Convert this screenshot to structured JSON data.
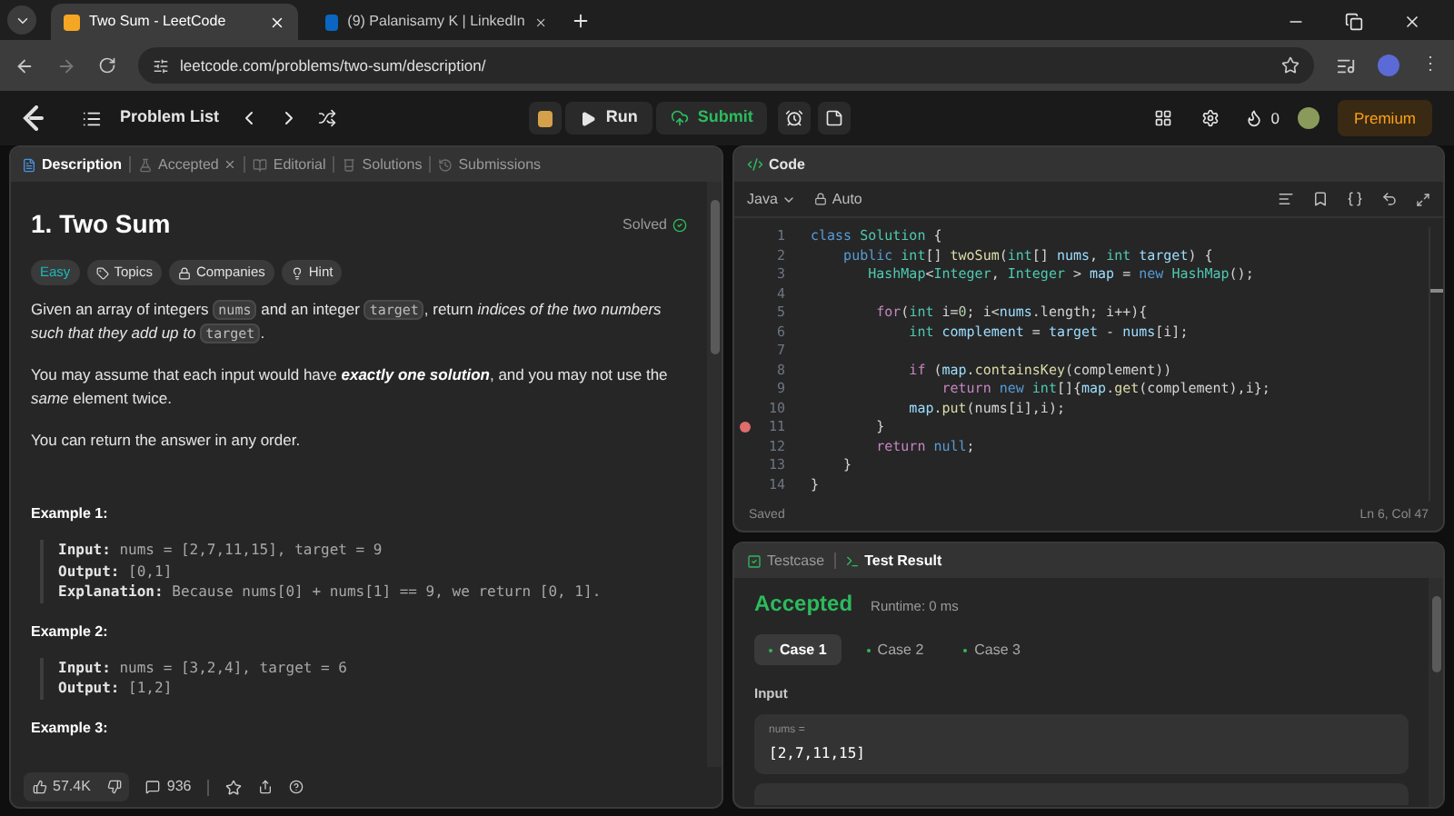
{
  "browser": {
    "tabs": [
      {
        "title": "Two Sum - LeetCode",
        "selected": true
      },
      {
        "title": "(9) Palanisamy K | LinkedIn",
        "selected": false
      }
    ],
    "url": "leetcode.com/problems/two-sum/description/"
  },
  "nav": {
    "more": "⋮",
    "problem_list": "Problem List",
    "run": "Run",
    "submit": "Submit",
    "streak": "0",
    "premium": "Premium"
  },
  "left_tabs": [
    {
      "label": "Description",
      "selected": true,
      "closable": false
    },
    {
      "label": "Accepted",
      "selected": false,
      "closable": true
    },
    {
      "label": "Editorial",
      "selected": false,
      "closable": false
    },
    {
      "label": "Solutions",
      "selected": false,
      "closable": false
    },
    {
      "label": "Submissions",
      "selected": false,
      "closable": false
    }
  ],
  "problem": {
    "title": "1. Two Sum",
    "status": "Solved",
    "tags": [
      {
        "label": "Easy",
        "kind": "difficulty"
      },
      {
        "label": "Topics",
        "kind": "topics"
      },
      {
        "label": "Companies",
        "kind": "companies"
      },
      {
        "label": "Hint",
        "kind": "hint"
      }
    ],
    "paragraphs": [
      [
        {
          "text": "Given an array of integers ",
          "kind": "text"
        },
        {
          "text": "nums",
          "kind": "code"
        },
        {
          "text": " and an integer ",
          "kind": "text"
        },
        {
          "text": "target",
          "kind": "code"
        },
        {
          "text": ", return ",
          "kind": "text"
        },
        {
          "text": "indices of the two numbers such that they add up to ",
          "kind": "italic"
        },
        {
          "text": "target",
          "kind": "code"
        },
        {
          "text": ".",
          "kind": "text"
        }
      ],
      [
        {
          "text": "You may assume that each input would have ",
          "kind": "text"
        },
        {
          "text": "exactly one solution",
          "kind": "bolditalic"
        },
        {
          "text": ", and you may not use the ",
          "kind": "text"
        },
        {
          "text": "same",
          "kind": "italic"
        },
        {
          "text": " element twice.",
          "kind": "text"
        }
      ],
      [
        {
          "text": "You can return the answer in any order.",
          "kind": "text"
        }
      ]
    ],
    "examples": [
      {
        "title": "Example 1:",
        "lines": [
          {
            "label": "Input:",
            "value": "nums = [2,7,11,15], target = 9"
          },
          {
            "label": "Output:",
            "value": "[0,1]"
          },
          {
            "label": "Explanation:",
            "value": "Because nums[0] + nums[1] == 9, we return [0, 1]."
          }
        ]
      },
      {
        "title": "Example 2:",
        "lines": [
          {
            "label": "Input:",
            "value": "nums = [3,2,4], target = 6"
          },
          {
            "label": "Output:",
            "value": "[1,2]"
          }
        ]
      },
      {
        "title": "Example 3:"
      }
    ]
  },
  "footer": {
    "likes": "57.4K",
    "comments": "936"
  },
  "code": {
    "title": "Code",
    "language": "Java",
    "mode": "Auto",
    "status": "Saved",
    "cursor": "Ln 6, Col 47",
    "lines": [
      {
        "number": "1",
        "breakpoint": false,
        "tokens": [
          {
            "text": "class ",
            "kind": "keyword"
          },
          {
            "text": "Solution",
            "kind": "type"
          },
          {
            "text": " {",
            "kind": "plain"
          }
        ]
      },
      {
        "number": "2",
        "breakpoint": false,
        "tokens": [
          {
            "text": "    public ",
            "kind": "keyword"
          },
          {
            "text": "int",
            "kind": "type"
          },
          {
            "text": "[] ",
            "kind": "plain"
          },
          {
            "text": "twoSum",
            "kind": "function"
          },
          {
            "text": "(",
            "kind": "plain"
          },
          {
            "text": "int",
            "kind": "type"
          },
          {
            "text": "[] ",
            "kind": "plain"
          },
          {
            "text": "nums",
            "kind": "variable"
          },
          {
            "text": ", ",
            "kind": "plain"
          },
          {
            "text": "int",
            "kind": "type"
          },
          {
            "text": " target",
            "kind": "variable"
          },
          {
            "text": ") {",
            "kind": "plain"
          }
        ]
      },
      {
        "number": "3",
        "breakpoint": false,
        "tokens": [
          {
            "text": "       HashMap",
            "kind": "type"
          },
          {
            "text": "<",
            "kind": "plain"
          },
          {
            "text": "Integer",
            "kind": "type"
          },
          {
            "text": ", ",
            "kind": "plain"
          },
          {
            "text": "Integer",
            "kind": "type"
          },
          {
            "text": " > ",
            "kind": "plain"
          },
          {
            "text": "map",
            "kind": "variable"
          },
          {
            "text": " = ",
            "kind": "plain"
          },
          {
            "text": "new ",
            "kind": "keyword"
          },
          {
            "text": "HashMap",
            "kind": "type"
          },
          {
            "text": "();",
            "kind": "plain"
          }
        ]
      },
      {
        "number": "4",
        "breakpoint": false
      },
      {
        "number": "5",
        "breakpoint": false,
        "tokens": [
          {
            "text": "        for",
            "kind": "control"
          },
          {
            "text": "(",
            "kind": "plain"
          },
          {
            "text": "int",
            "kind": "type"
          },
          {
            "text": " i=",
            "kind": "plain"
          },
          {
            "text": "0",
            "kind": "number"
          },
          {
            "text": "; i<",
            "kind": "plain"
          },
          {
            "text": "nums",
            "kind": "variable"
          },
          {
            "text": ".length; i++){",
            "kind": "plain"
          }
        ]
      },
      {
        "number": "6",
        "breakpoint": false,
        "tokens": [
          {
            "text": "            int",
            "kind": "type"
          },
          {
            "text": " complement",
            "kind": "variable"
          },
          {
            "text": " = ",
            "kind": "plain"
          },
          {
            "text": "target",
            "kind": "variable"
          },
          {
            "text": " - ",
            "kind": "plain"
          },
          {
            "text": "nums",
            "kind": "variable"
          },
          {
            "text": "[i];",
            "kind": "plain"
          }
        ]
      },
      {
        "number": "7",
        "breakpoint": false
      },
      {
        "number": "8",
        "breakpoint": false,
        "tokens": [
          {
            "text": "            if",
            "kind": "control"
          },
          {
            "text": " (",
            "kind": "plain"
          },
          {
            "text": "map",
            "kind": "variable"
          },
          {
            "text": ".",
            "kind": "plain"
          },
          {
            "text": "containsKey",
            "kind": "function"
          },
          {
            "text": "(complement))",
            "kind": "plain"
          }
        ]
      },
      {
        "number": "9",
        "breakpoint": false,
        "tokens": [
          {
            "text": "                return",
            "kind": "control"
          },
          {
            "text": " new ",
            "kind": "keyword"
          },
          {
            "text": "int",
            "kind": "type"
          },
          {
            "text": "[]{",
            "kind": "plain"
          },
          {
            "text": "map",
            "kind": "variable"
          },
          {
            "text": ".",
            "kind": "plain"
          },
          {
            "text": "get",
            "kind": "function"
          },
          {
            "text": "(complement),i};",
            "kind": "plain"
          }
        ]
      },
      {
        "number": "10",
        "breakpoint": false,
        "tokens": [
          {
            "text": "            map",
            "kind": "variable"
          },
          {
            "text": ".",
            "kind": "plain"
          },
          {
            "text": "put",
            "kind": "function"
          },
          {
            "text": "(nums[i],i);",
            "kind": "plain"
          }
        ]
      },
      {
        "number": "11",
        "breakpoint": true,
        "tokens": [
          {
            "text": "        }",
            "kind": "plain"
          }
        ]
      },
      {
        "number": "12",
        "breakpoint": false,
        "tokens": [
          {
            "text": "        return",
            "kind": "control"
          },
          {
            "text": " null",
            "kind": "keyword"
          },
          {
            "text": ";",
            "kind": "plain"
          }
        ]
      },
      {
        "number": "13",
        "breakpoint": false,
        "tokens": [
          {
            "text": "    }",
            "kind": "plain"
          }
        ]
      },
      {
        "number": "14",
        "breakpoint": false,
        "tokens": [
          {
            "text": "}",
            "kind": "plain"
          }
        ]
      }
    ]
  },
  "test": {
    "tabs": [
      {
        "label": "Testcase",
        "selected": false
      },
      {
        "label": "Test Result",
        "selected": true
      }
    ],
    "verdict": "Accepted",
    "runtime": "Runtime: 0 ms",
    "cases": [
      {
        "label": "Case 1",
        "selected": true
      },
      {
        "label": "Case 2",
        "selected": false
      },
      {
        "label": "Case 3",
        "selected": false
      }
    ],
    "input_label": "Input",
    "inputs": [
      {
        "name": "nums =",
        "value": "[2,7,11,15]"
      }
    ]
  }
}
